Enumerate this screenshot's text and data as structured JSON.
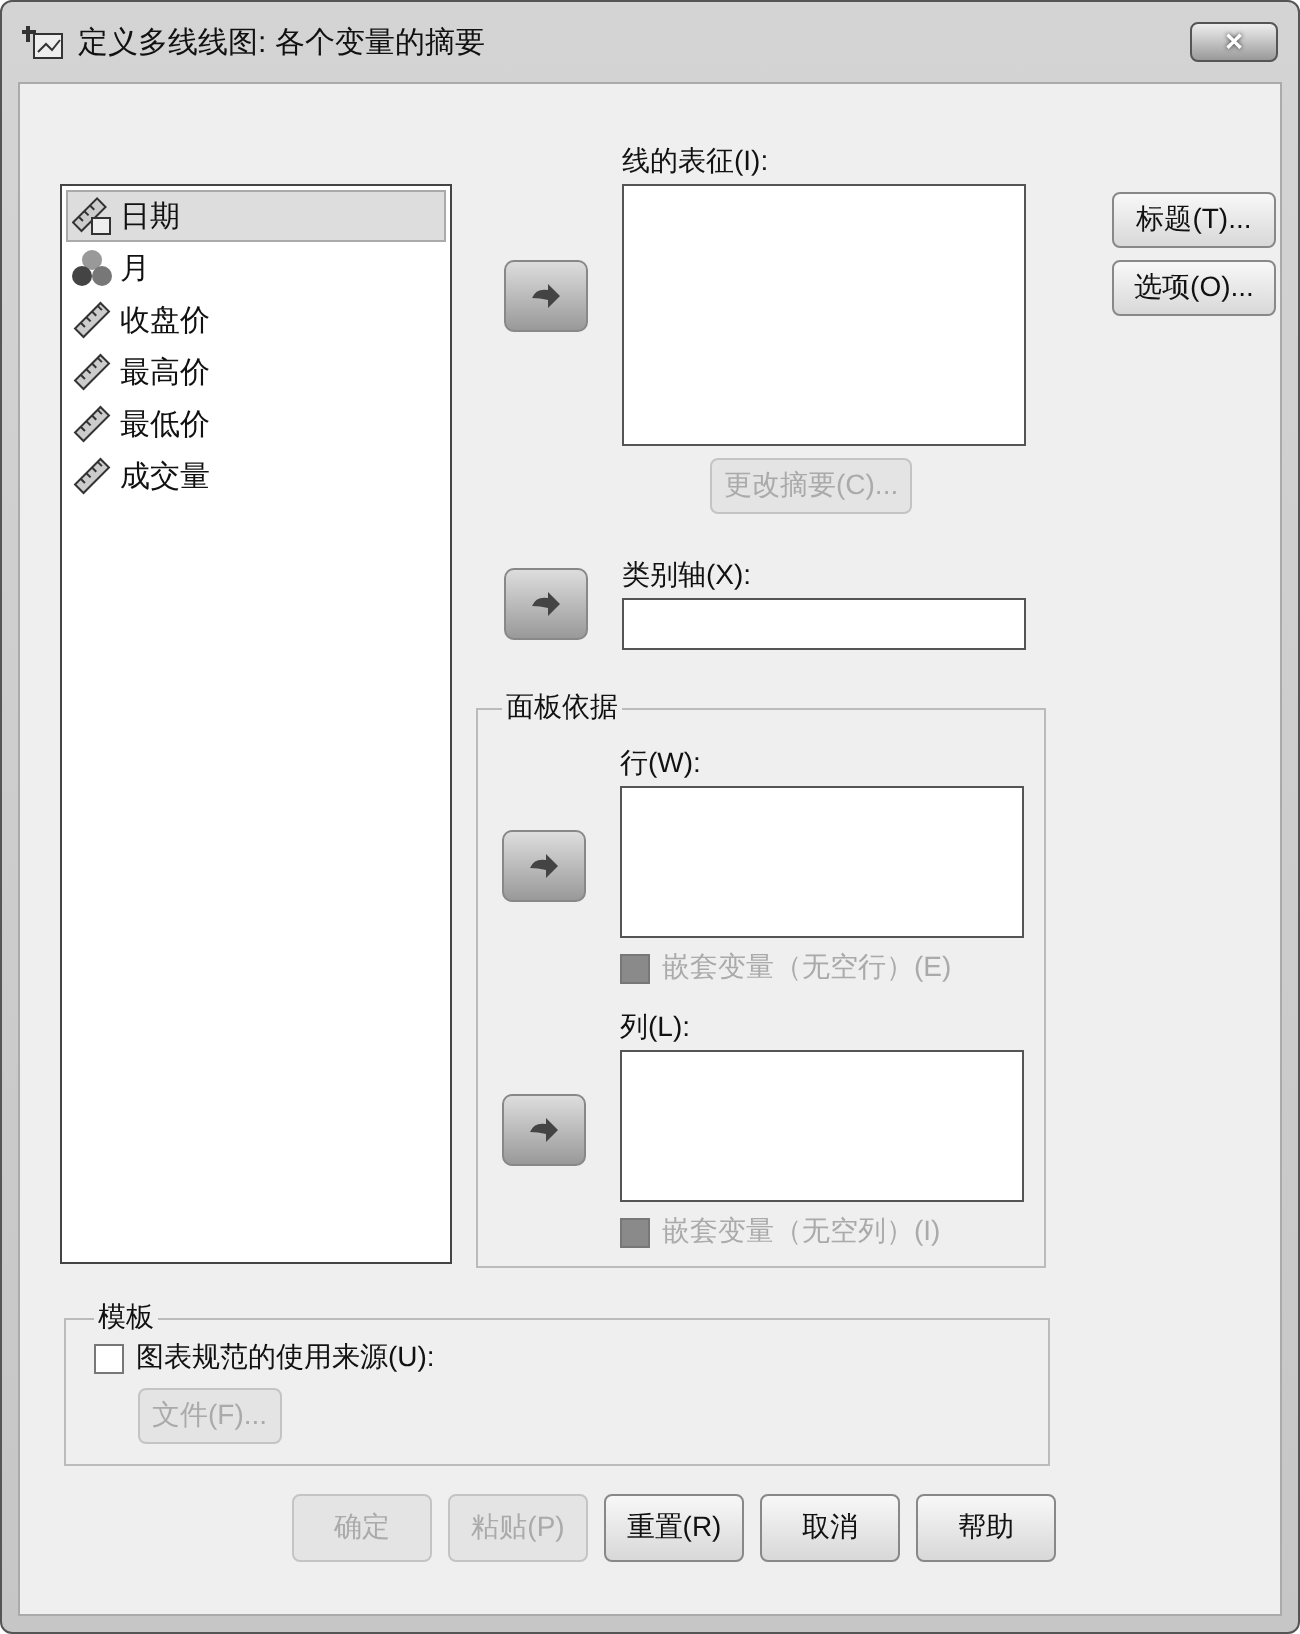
{
  "window": {
    "title": "定义多线线图: 各个变量的摘要",
    "close_label": "✕"
  },
  "variables": [
    {
      "label": "日期",
      "kind": "date",
      "selected": true
    },
    {
      "label": "月",
      "kind": "nominal",
      "selected": false
    },
    {
      "label": "收盘价",
      "kind": "scale",
      "selected": false
    },
    {
      "label": "最高价",
      "kind": "scale",
      "selected": false
    },
    {
      "label": "最低价",
      "kind": "scale",
      "selected": false
    },
    {
      "label": "成交量",
      "kind": "scale",
      "selected": false
    }
  ],
  "lines_represent": {
    "label": "线的表征(I):",
    "button": {
      "label": "更改摘要(C)...",
      "disabled": true
    }
  },
  "category_axis": {
    "label": "类别轴(X):"
  },
  "panel_by": {
    "title": "面板依据",
    "rows": {
      "label": "行(W):",
      "nest": {
        "label": "嵌套变量（无空行）(E)",
        "checked": false,
        "disabled": true
      }
    },
    "columns": {
      "label": "列(L):",
      "nest": {
        "label": "嵌套变量（无空列）(I)",
        "checked": false,
        "disabled": true
      }
    }
  },
  "side_buttons": [
    {
      "label": "标题(T)...",
      "disabled": false
    },
    {
      "label": "选项(O)...",
      "disabled": false
    }
  ],
  "template": {
    "title": "模板",
    "checkbox": {
      "label": "图表规范的使用来源(U):",
      "checked": false,
      "disabled": false
    },
    "file_button": {
      "label": "文件(F)...",
      "disabled": true
    }
  },
  "buttons": [
    {
      "label": "确定",
      "disabled": true
    },
    {
      "label": "粘贴(P)",
      "disabled": true
    },
    {
      "label": "重置(R)",
      "disabled": false
    },
    {
      "label": "取消",
      "disabled": false
    },
    {
      "label": "帮助",
      "disabled": false
    }
  ]
}
